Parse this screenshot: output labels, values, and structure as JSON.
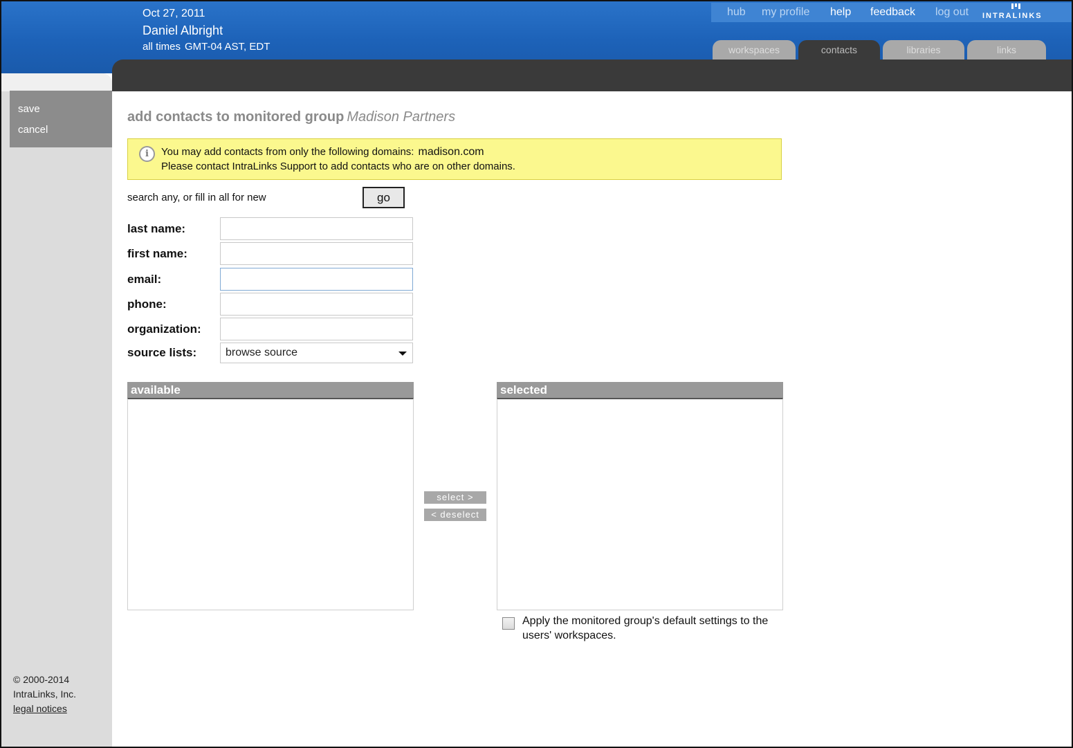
{
  "header": {
    "date": "Oct 27, 2011",
    "user": "Daniel Albright",
    "tz_label": "all times",
    "tz_value": "GMT-04 AST, EDT",
    "nav": {
      "hub": "hub",
      "my_profile": "my profile",
      "help": "help",
      "feedback": "feedback",
      "log_out": "log out"
    },
    "logo_text": "INTRALINKS",
    "tabs": [
      {
        "label": "workspaces",
        "active": false
      },
      {
        "label": "contacts",
        "active": true
      },
      {
        "label": "libraries",
        "active": false
      },
      {
        "label": "links",
        "active": false
      }
    ]
  },
  "sidebar": {
    "save": "save",
    "cancel": "cancel",
    "copyright": "© 2000-2014",
    "company": "IntraLinks, Inc.",
    "legal": "legal notices"
  },
  "main": {
    "title": "add contacts to monitored group",
    "group_name": "Madison Partners",
    "notice": {
      "line1": "You may add contacts from only the following domains:",
      "domain": "madison.com",
      "line2": "Please contact IntraLinks Support to add contacts who are on other domains."
    },
    "search_hint": "search any, or fill in all for new",
    "go_label": "go",
    "fields": {
      "last_name": "last name:",
      "first_name": "first name:",
      "email": "email:",
      "phone": "phone:",
      "organization": "organization:",
      "source_lists": "source lists:"
    },
    "values": {
      "last_name": "",
      "first_name": "",
      "email": "",
      "phone": "",
      "organization": ""
    },
    "source_selected": "browse source",
    "available_label": "available",
    "selected_label": "selected",
    "select_btn": "select >",
    "deselect_btn": "< deselect",
    "apply_defaults": "Apply the monitored group's default settings to the users' workspaces."
  }
}
